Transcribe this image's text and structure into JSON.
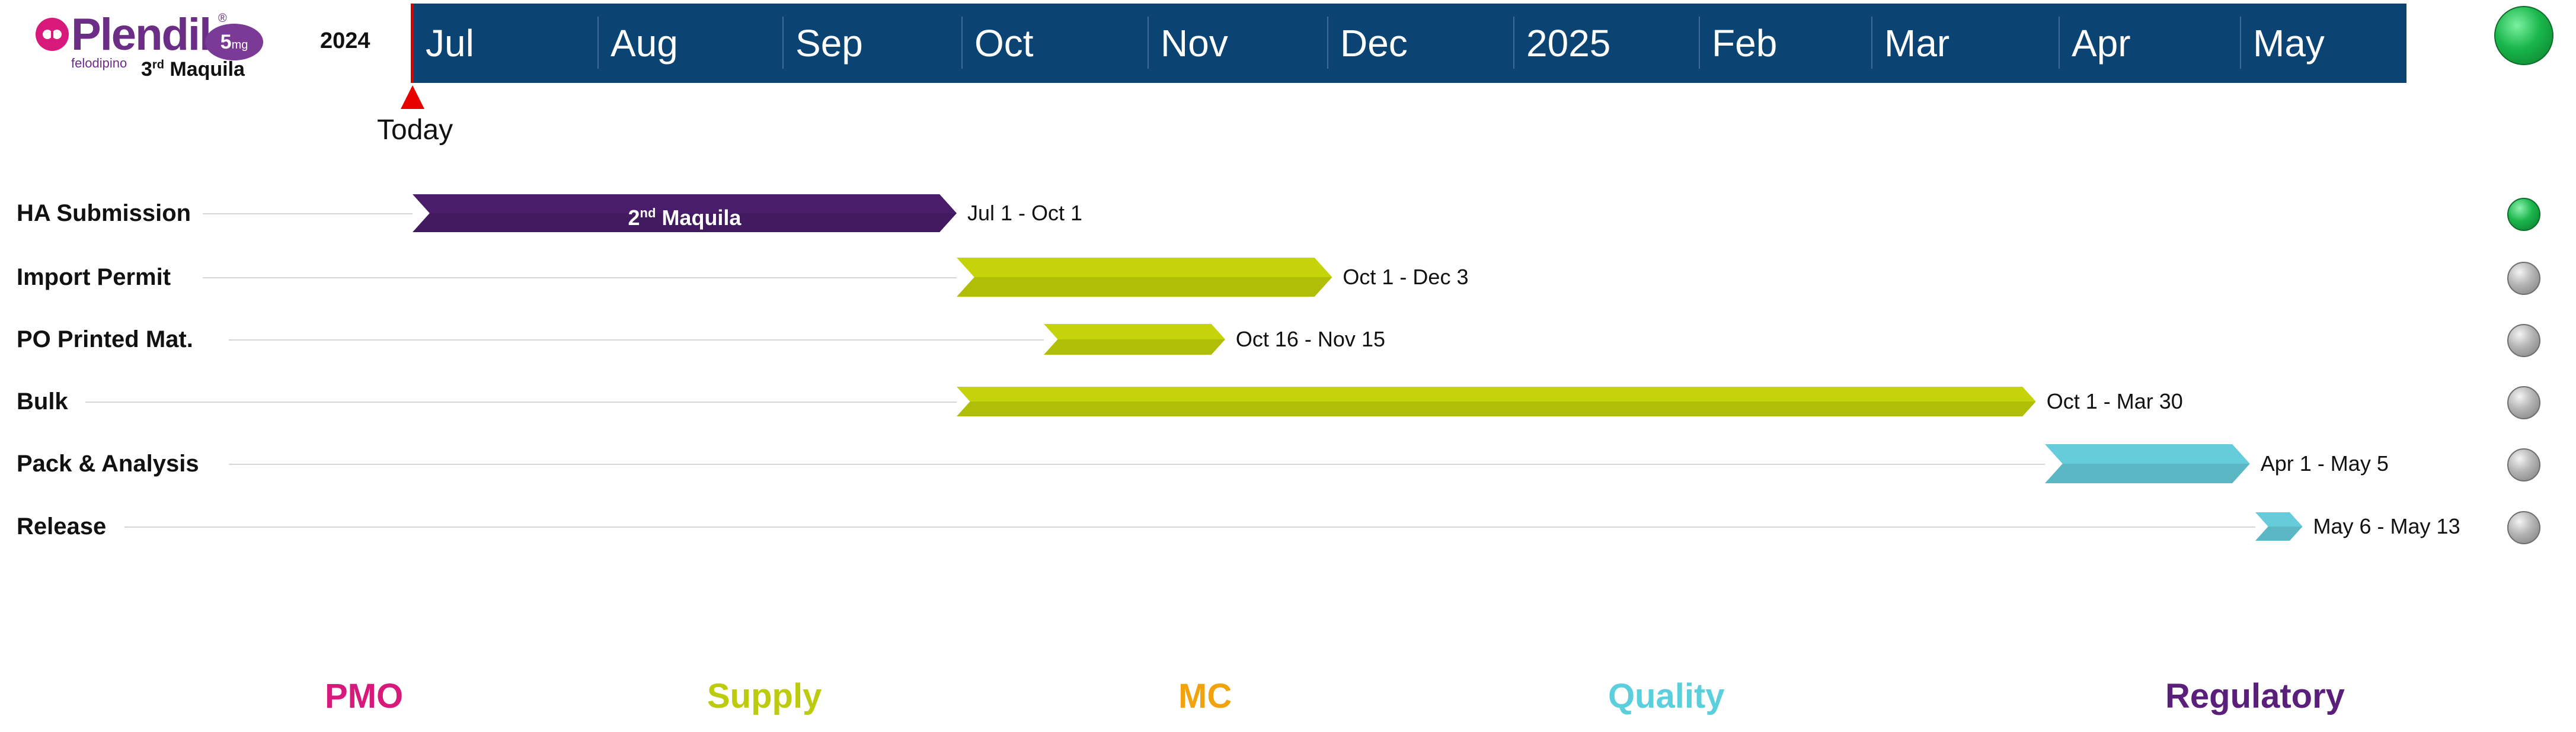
{
  "logo": {
    "brand": "Plendil",
    "reg": "®",
    "dose_value": "5",
    "dose_unit": "mg",
    "generic": "felodipino",
    "maquila_number": "3",
    "maquila_suffix": "rd",
    "maquila_word": "Maquila"
  },
  "timeline": {
    "year_label": "2024",
    "months": [
      {
        "label": "Jul",
        "start": 0.0,
        "end": 0.0333
      },
      {
        "label": "Aug",
        "start": 0.0333,
        "end": 0.0667
      },
      {
        "label": "Sep",
        "start": 0.0667,
        "end": 0.1
      },
      {
        "label": "Oct",
        "start": 0.1,
        "end": 0.1333
      },
      {
        "label": "Nov",
        "start": 0.1333,
        "end": 0.1667
      },
      {
        "label": "Dec",
        "start": 0.1667,
        "end": 0.2
      },
      {
        "label": "2025",
        "start": 0.2,
        "end": 0.2333
      },
      {
        "label": "Feb",
        "start": 0.2333,
        "end": 0.2667
      },
      {
        "label": "Mar",
        "start": 0.2667,
        "end": 0.3
      },
      {
        "label": "Apr",
        "start": 0.3,
        "end": 0.3333
      },
      {
        "label": "May",
        "start": 0.3333,
        "end": 0.3667
      }
    ],
    "today_label": "Today",
    "overall_status": "green"
  },
  "tasks": [
    {
      "name": "HA Submission",
      "bar_text": "2",
      "bar_text_sup": "nd",
      "bar_text_rest": " Maquila",
      "start_month": 0.0,
      "end_month": 3.0,
      "range": "Jul 1 - Oct 1",
      "color": "#4a1d6a",
      "status": "green"
    },
    {
      "name": "Import Permit",
      "bar_text": "",
      "bar_text_sup": "",
      "bar_text_rest": "",
      "start_month": 3.0,
      "end_month": 5.07,
      "range": "Oct 1 - Dec 3",
      "color": "#c5d40a",
      "status": "grey"
    },
    {
      "name": "PO Printed Mat.",
      "bar_text": "",
      "bar_text_sup": "",
      "bar_text_rest": "",
      "start_month": 3.48,
      "end_month": 4.48,
      "range": "Oct 16 - Nov 15",
      "color": "#c5d40a",
      "status": "grey"
    },
    {
      "name": "Bulk",
      "bar_text": "",
      "bar_text_sup": "",
      "bar_text_rest": "",
      "start_month": 3.0,
      "end_month": 8.95,
      "range": "Oct 1 - Mar 30",
      "color": "#c5d40a",
      "status": "grey"
    },
    {
      "name": "Pack & Analysis",
      "bar_text": "",
      "bar_text_sup": "",
      "bar_text_rest": "",
      "start_month": 9.0,
      "end_month": 10.13,
      "range": "Apr 1 - May 5",
      "color": "#66ccdb",
      "status": "grey"
    },
    {
      "name": "Release",
      "bar_text": "",
      "bar_text_sup": "",
      "bar_text_rest": "",
      "start_month": 10.16,
      "end_month": 10.42,
      "range": "May 6 - May 13",
      "color": "#66ccdb",
      "status": "grey"
    }
  ],
  "legend": [
    {
      "label": "PMO",
      "color": "#d6197a"
    },
    {
      "label": "Supply",
      "color": "#bccb0e"
    },
    {
      "label": "MC",
      "color": "#f0a30a"
    },
    {
      "label": "Quality",
      "color": "#5ccfdc"
    },
    {
      "label": "Regulatory",
      "color": "#5a1f7a"
    }
  ]
}
